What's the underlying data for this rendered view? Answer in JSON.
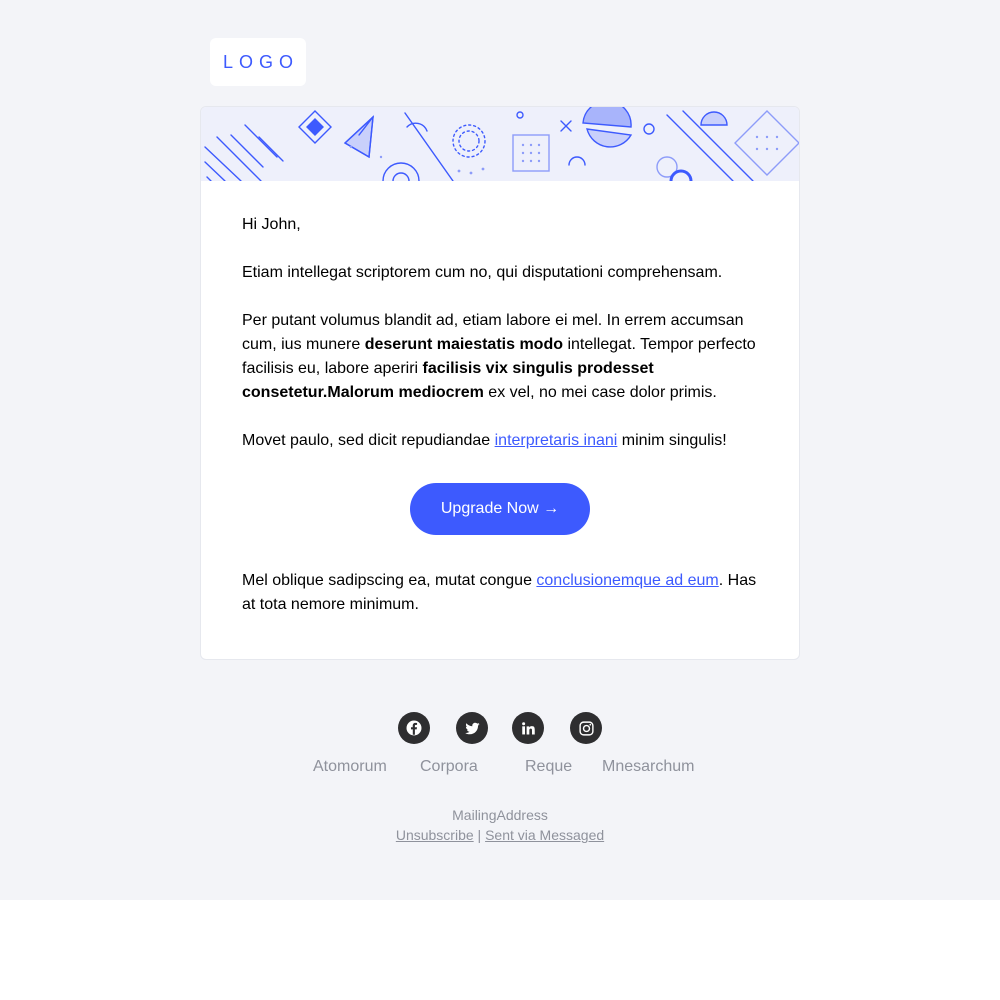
{
  "colors": {
    "accent": "#3d5afe",
    "page_background": "#f3f4f8",
    "card_background": "#ffffff",
    "banner_background": "#eef0fb",
    "social_icon_background": "#2e2e30",
    "footer_text": "#8f929c"
  },
  "header": {
    "logo_text": "LOGO"
  },
  "email": {
    "greeting": "Hi John,",
    "paragraph1": "Etiam intellegat scriptorem cum no, qui disputationi comprehensam.",
    "paragraph2": {
      "part1": "Per putant volumus blandit ad, etiam labore ei mel. In errem accumsan cum, ius munere ",
      "bold1": "deserunt maiestatis modo",
      "part2": " intellegat. Tempor perfecto facilisis eu, labore aperiri ",
      "bold2": "facilisis vix singulis prodesset consetetur.Malorum mediocrem",
      "part3": " ex vel, no mei case dolor primis."
    },
    "paragraph3": {
      "before_link": "Movet paulo, sed dicit repudiandae ",
      "link": "interpretaris inani",
      "after_link": " minim singulis!"
    },
    "cta_label": "Upgrade Now →",
    "paragraph4": {
      "before_link": "Mel oblique sadipscing ea, mutat congue ",
      "link": "conclusionemque ad eum",
      "after_link": ". Has at tota nemore minimum."
    }
  },
  "footer": {
    "social_icons": [
      "facebook-icon",
      "twitter-icon",
      "linkedin-icon",
      "instagram-icon"
    ],
    "links": [
      "Atomorum",
      "Corpora",
      "Reque",
      "Mnesarchum"
    ],
    "mailing_address": "MailingAddress",
    "unsubscribe_label": "Unsubscribe",
    "separator": "|",
    "sent_via_label": "Sent via Messaged"
  }
}
